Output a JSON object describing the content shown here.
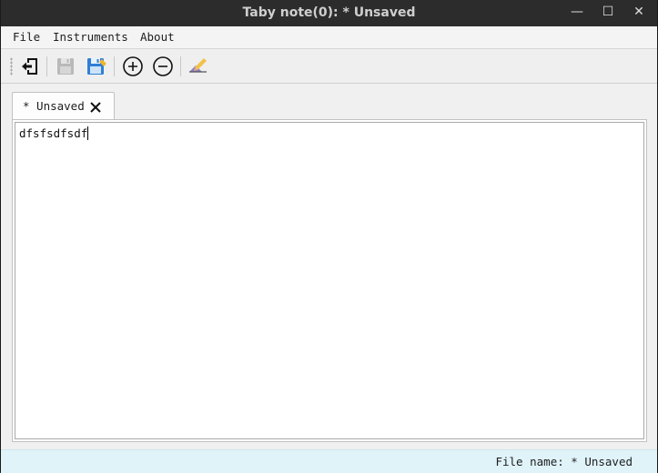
{
  "window": {
    "title": "Taby note(0): * Unsaved",
    "min_glyph": "—",
    "max_glyph": "☐",
    "close_glyph": "✕"
  },
  "menu": {
    "items": [
      {
        "label": "File"
      },
      {
        "label": "Instruments"
      },
      {
        "label": "About"
      }
    ]
  },
  "toolbar": {
    "buttons": [
      {
        "name": "open",
        "icon": "exit-door-arrow-icon"
      },
      {
        "name": "save",
        "icon": "floppy-disabled-icon",
        "enabled": false
      },
      {
        "name": "save-as",
        "icon": "floppy-blue-icon"
      },
      {
        "name": "zoom-in",
        "icon": "plus-circle-icon"
      },
      {
        "name": "zoom-out",
        "icon": "minus-circle-icon"
      },
      {
        "name": "clear",
        "icon": "eraser-pencil-icon"
      }
    ]
  },
  "tabs": [
    {
      "label": "* Unsaved",
      "active": true
    }
  ],
  "editor": {
    "text": "dfsfsdfsdf"
  },
  "status": {
    "text": "File name: * Unsaved"
  },
  "colors": {
    "titlebar": "#2c2c2c",
    "status_bg": "#dff3f9",
    "save_blue": "#2f7fd6"
  }
}
